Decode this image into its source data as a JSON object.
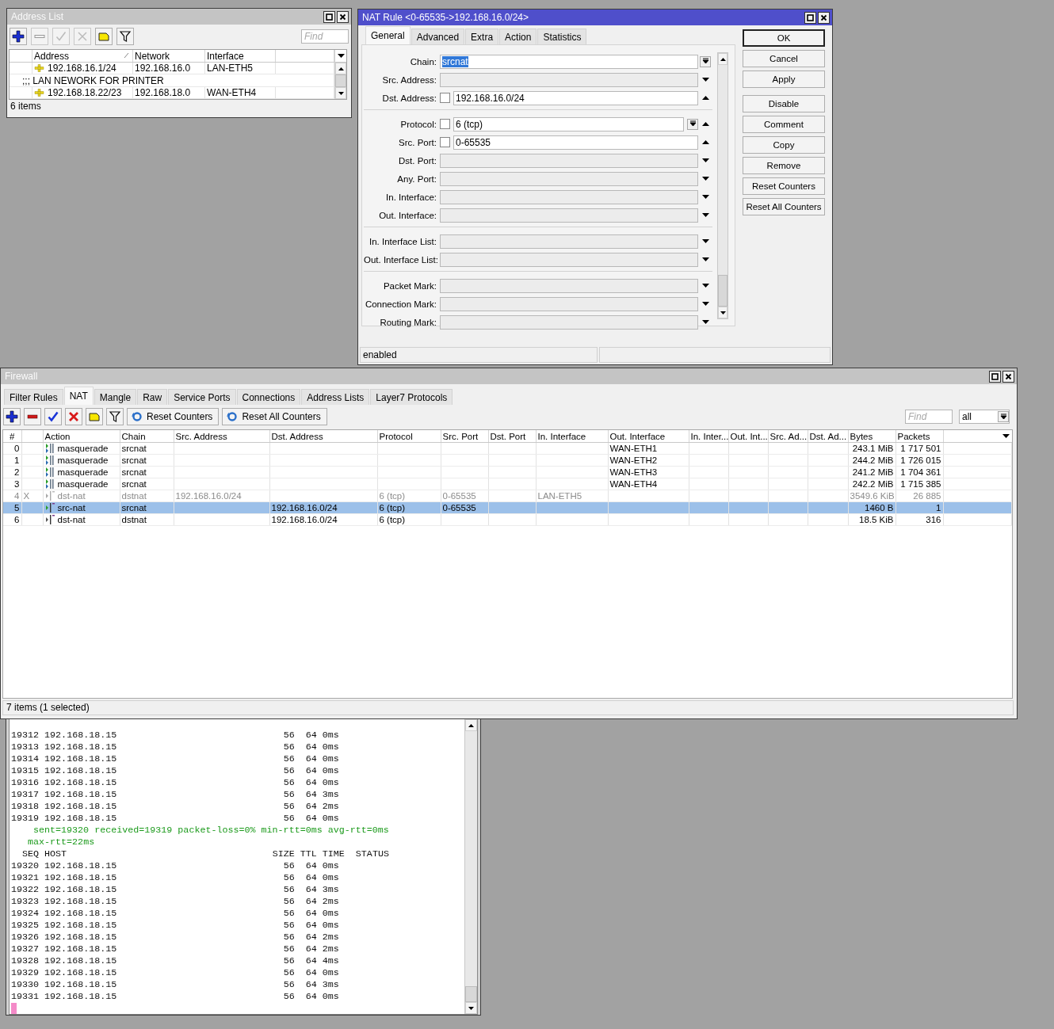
{
  "address_list": {
    "title": "Address List",
    "active": false,
    "toolbar": [
      {
        "kind": "add",
        "disabled": false
      },
      {
        "kind": "remove",
        "disabled": true
      },
      {
        "kind": "enable",
        "disabled": true
      },
      {
        "kind": "disable",
        "disabled": true
      },
      {
        "kind": "comment",
        "disabled": false
      },
      {
        "kind": "filter",
        "disabled": false
      }
    ],
    "find": {
      "placeholder": "Find"
    },
    "columns": [
      "Address",
      "Network",
      "Interface"
    ],
    "rows": [
      {
        "kind": "address",
        "address": "192.168.16.1/24",
        "network": "192.168.16.0",
        "interface": "LAN-ETH5"
      },
      {
        "kind": "comment",
        "text": ";;; LAN NEWORK FOR PRINTER"
      },
      {
        "kind": "address",
        "address": "192.168.18.22/23",
        "network": "192.168.18.0",
        "interface": "WAN-ETH4"
      }
    ],
    "status": "6 items"
  },
  "nat_rule": {
    "title": "NAT Rule <0-65535->192.168.16.0/24>",
    "active": true,
    "tabs": [
      {
        "label": "General",
        "selected": true
      },
      {
        "label": "Advanced",
        "selected": false
      },
      {
        "label": "Extra",
        "selected": false
      },
      {
        "label": "Action",
        "selected": false
      },
      {
        "label": "Statistics",
        "selected": false
      }
    ],
    "field_groups": [
      [
        {
          "label": "Chain:",
          "value": "srcnat",
          "text_selected": true,
          "dropdown": true
        },
        {
          "label": "Src. Address:",
          "dropdown": false,
          "expanded": false
        },
        {
          "label": "Dst. Address:",
          "value": "192.168.16.0/24",
          "checked": false,
          "text_selected": false,
          "dropdown": false,
          "expanded": true
        }
      ],
      [
        {
          "label": "Protocol:",
          "value": "6 (tcp)",
          "checked": false,
          "text_selected": false,
          "dropdown": true,
          "expanded": true
        },
        {
          "label": "Src. Port:",
          "value": "0-65535",
          "checked": false,
          "text_selected": false,
          "dropdown": false,
          "expanded": true
        },
        {
          "label": "Dst. Port:",
          "dropdown": false,
          "expanded": false
        },
        {
          "label": "Any. Port:",
          "dropdown": false,
          "expanded": false
        },
        {
          "label": "In. Interface:",
          "dropdown": false,
          "expanded": false
        },
        {
          "label": "Out. Interface:",
          "dropdown": false,
          "expanded": false
        }
      ],
      [
        {
          "label": "In. Interface List:",
          "dropdown": false,
          "expanded": false
        },
        {
          "label": "Out. Interface List:",
          "dropdown": false,
          "expanded": false
        }
      ],
      [
        {
          "label": "Packet Mark:",
          "dropdown": false,
          "expanded": false
        },
        {
          "label": "Connection Mark:",
          "dropdown": false,
          "expanded": false
        },
        {
          "label": "Routing Mark:",
          "dropdown": false,
          "expanded": false
        }
      ]
    ],
    "buttons": [
      {
        "label": "OK",
        "default": true
      },
      {
        "label": "Cancel",
        "default": false
      },
      {
        "label": "Apply",
        "default": false
      },
      {
        "label": "Disable",
        "default": false
      },
      {
        "label": "Comment",
        "default": false
      },
      {
        "label": "Copy",
        "default": false
      },
      {
        "label": "Remove",
        "default": false
      },
      {
        "label": "Reset Counters",
        "default": false
      },
      {
        "label": "Reset All Counters",
        "default": false
      }
    ],
    "status": "enabled"
  },
  "firewall": {
    "title": "Firewall",
    "active": false,
    "tabs": [
      {
        "label": "Filter Rules",
        "selected": false
      },
      {
        "label": "NAT",
        "selected": true
      },
      {
        "label": "Mangle",
        "selected": false
      },
      {
        "label": "Raw",
        "selected": false
      },
      {
        "label": "Service Ports",
        "selected": false
      },
      {
        "label": "Connections",
        "selected": false
      },
      {
        "label": "Address Lists",
        "selected": false
      },
      {
        "label": "Layer7 Protocols",
        "selected": false
      }
    ],
    "toolbar": [
      {
        "kind": "add",
        "disabled": false
      },
      {
        "kind": "remove",
        "disabled": false
      },
      {
        "kind": "enable",
        "disabled": false
      },
      {
        "kind": "disable",
        "disabled": false
      },
      {
        "kind": "comment",
        "disabled": false
      },
      {
        "kind": "filter",
        "disabled": false
      },
      {
        "kind": "reset",
        "label": "Reset Counters",
        "disabled": false
      },
      {
        "kind": "reset",
        "label": "Reset All Counters",
        "disabled": false
      }
    ],
    "find": {
      "placeholder": "Find"
    },
    "filter_value": "all",
    "columns": [
      "#",
      "Action",
      "Chain",
      "Src. Address",
      "Dst. Address",
      "Protocol",
      "Src. Port",
      "Dst. Port",
      "In. Interface",
      "Out. Interface",
      "In. Inter...",
      "Out. Int...",
      "Src. Ad...",
      "Dst. Ad...",
      "Bytes",
      "Packets"
    ],
    "rows": [
      {
        "kind": "masquerade",
        "cells": [
          "0",
          "masquerade",
          "srcnat",
          null,
          null,
          null,
          null,
          null,
          null,
          "WAN-ETH1",
          null,
          null,
          null,
          null,
          "243.1 MiB",
          "1 717 501"
        ],
        "disabled": false,
        "selected": false
      },
      {
        "kind": "masquerade",
        "cells": [
          "1",
          "masquerade",
          "srcnat",
          null,
          null,
          null,
          null,
          null,
          null,
          "WAN-ETH2",
          null,
          null,
          null,
          null,
          "244.2 MiB",
          "1 726 015"
        ],
        "disabled": false,
        "selected": false
      },
      {
        "kind": "masquerade",
        "cells": [
          "2",
          "masquerade",
          "srcnat",
          null,
          null,
          null,
          null,
          null,
          null,
          "WAN-ETH3",
          null,
          null,
          null,
          null,
          "241.2 MiB",
          "1 704 361"
        ],
        "disabled": false,
        "selected": false
      },
      {
        "kind": "masquerade",
        "cells": [
          "3",
          "masquerade",
          "srcnat",
          null,
          null,
          null,
          null,
          null,
          null,
          "WAN-ETH4",
          null,
          null,
          null,
          null,
          "242.2 MiB",
          "1 715 385"
        ],
        "disabled": false,
        "selected": false
      },
      {
        "kind": "dstnat",
        "flag": "X",
        "cells": [
          "4",
          "dst-nat",
          "dstnat",
          "192.168.16.0/24",
          null,
          "6 (tcp)",
          "0-65535",
          null,
          "LAN-ETH5",
          null,
          null,
          null,
          null,
          null,
          "3549.6 KiB",
          "26 885"
        ],
        "disabled": true,
        "selected": false
      },
      {
        "kind": "srcnat",
        "cells": [
          "5",
          "src-nat",
          "srcnat",
          null,
          "192.168.16.0/24",
          "6 (tcp)",
          "0-65535",
          null,
          null,
          null,
          null,
          null,
          null,
          null,
          "1460 B",
          "1"
        ],
        "disabled": false,
        "selected": true
      },
      {
        "kind": "dstnat",
        "cells": [
          "6",
          "dst-nat",
          "dstnat",
          null,
          "192.168.16.0/24",
          "6 (tcp)",
          null,
          null,
          null,
          null,
          null,
          null,
          null,
          null,
          "18.5 KiB",
          "316"
        ],
        "disabled": false,
        "selected": false
      }
    ],
    "status": "7 items (1 selected)"
  },
  "terminal": {
    "lines": [
      {
        "kind": "reply",
        "seq": "19312",
        "host": "192.168.18.15",
        "size": "56",
        "ttl": "64",
        "time": "0ms"
      },
      {
        "kind": "reply",
        "seq": "19313",
        "host": "192.168.18.15",
        "size": "56",
        "ttl": "64",
        "time": "0ms"
      },
      {
        "kind": "reply",
        "seq": "19314",
        "host": "192.168.18.15",
        "size": "56",
        "ttl": "64",
        "time": "0ms"
      },
      {
        "kind": "reply",
        "seq": "19315",
        "host": "192.168.18.15",
        "size": "56",
        "ttl": "64",
        "time": "0ms"
      },
      {
        "kind": "reply",
        "seq": "19316",
        "host": "192.168.18.15",
        "size": "56",
        "ttl": "64",
        "time": "0ms"
      },
      {
        "kind": "reply",
        "seq": "19317",
        "host": "192.168.18.15",
        "size": "56",
        "ttl": "64",
        "time": "3ms"
      },
      {
        "kind": "reply",
        "seq": "19318",
        "host": "192.168.18.15",
        "size": "56",
        "ttl": "64",
        "time": "2ms"
      },
      {
        "kind": "reply",
        "seq": "19319",
        "host": "192.168.18.15",
        "size": "56",
        "ttl": "64",
        "time": "0ms"
      },
      {
        "kind": "summary",
        "text": "sent=19320 received=19319 packet-loss=0% min-rtt=0ms avg-rtt=0ms"
      },
      {
        "kind": "summary_cont",
        "text": "max-rtt=22ms"
      },
      {
        "kind": "header",
        "seq": "SEQ",
        "host": "HOST",
        "size": "SIZE",
        "ttl": "TTL",
        "time": "TIME",
        "status": "STATUS"
      },
      {
        "kind": "reply",
        "seq": "19320",
        "host": "192.168.18.15",
        "size": "56",
        "ttl": "64",
        "time": "0ms"
      },
      {
        "kind": "reply",
        "seq": "19321",
        "host": "192.168.18.15",
        "size": "56",
        "ttl": "64",
        "time": "0ms"
      },
      {
        "kind": "reply",
        "seq": "19322",
        "host": "192.168.18.15",
        "size": "56",
        "ttl": "64",
        "time": "3ms"
      },
      {
        "kind": "reply",
        "seq": "19323",
        "host": "192.168.18.15",
        "size": "56",
        "ttl": "64",
        "time": "2ms"
      },
      {
        "kind": "reply",
        "seq": "19324",
        "host": "192.168.18.15",
        "size": "56",
        "ttl": "64",
        "time": "0ms"
      },
      {
        "kind": "reply",
        "seq": "19325",
        "host": "192.168.18.15",
        "size": "56",
        "ttl": "64",
        "time": "0ms"
      },
      {
        "kind": "reply",
        "seq": "19326",
        "host": "192.168.18.15",
        "size": "56",
        "ttl": "64",
        "time": "2ms"
      },
      {
        "kind": "reply",
        "seq": "19327",
        "host": "192.168.18.15",
        "size": "56",
        "ttl": "64",
        "time": "2ms"
      },
      {
        "kind": "reply",
        "seq": "19328",
        "host": "192.168.18.15",
        "size": "56",
        "ttl": "64",
        "time": "4ms"
      },
      {
        "kind": "reply",
        "seq": "19329",
        "host": "192.168.18.15",
        "size": "56",
        "ttl": "64",
        "time": "0ms"
      },
      {
        "kind": "reply",
        "seq": "19330",
        "host": "192.168.18.15",
        "size": "56",
        "ttl": "64",
        "time": "3ms"
      },
      {
        "kind": "reply",
        "seq": "19331",
        "host": "192.168.18.15",
        "size": "56",
        "ttl": "64",
        "time": "0ms"
      }
    ]
  }
}
